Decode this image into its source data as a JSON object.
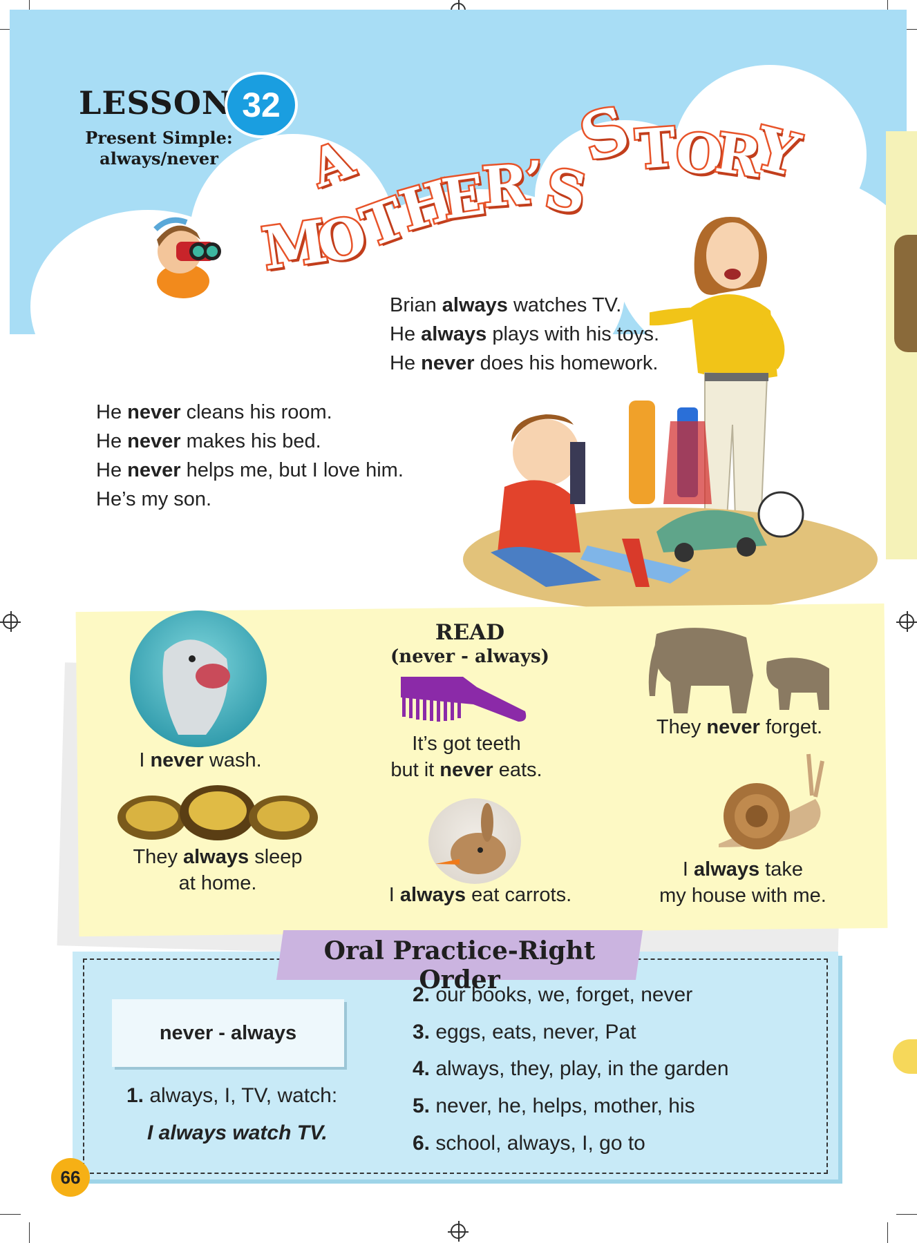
{
  "lesson": {
    "word": "LESSON",
    "number": "32",
    "subtitle_line1": "Present Simple:",
    "subtitle_line2": "always/never"
  },
  "title": {
    "letters_a": "A",
    "letters_mothers": [
      "M",
      "O",
      "T",
      "H",
      "E",
      "R",
      "’",
      "S"
    ],
    "letters_story": [
      "S",
      "T",
      "O",
      "R",
      "Y"
    ]
  },
  "story": {
    "right": [
      {
        "pre": "Brian ",
        "bold": "always",
        "post": " watches TV."
      },
      {
        "pre": "He ",
        "bold": "always",
        "post": " plays with his toys."
      },
      {
        "pre": "He ",
        "bold": "never",
        "post": " does his homework."
      }
    ],
    "left": [
      {
        "pre": "He ",
        "bold": "never",
        "post": " cleans his room."
      },
      {
        "pre": "He ",
        "bold": "never",
        "post": " makes his bed."
      },
      {
        "pre": "He ",
        "bold": "never",
        "post": " helps me, but I love him."
      },
      {
        "pre": "He’s my son.",
        "bold": "",
        "post": ""
      }
    ]
  },
  "read": {
    "heading": "READ",
    "subheading": "(never - always)",
    "captions": {
      "dolphin": {
        "pre": "I ",
        "bold": "never",
        "post": " wash."
      },
      "comb_l1": "It’s got teeth",
      "comb_l2": {
        "pre": "but it ",
        "bold": "never",
        "post": " eats."
      },
      "elephants": {
        "pre": "They ",
        "bold": "never",
        "post": " forget."
      },
      "tortoises_l1": {
        "pre": "They ",
        "bold": "always",
        "post": " sleep"
      },
      "tortoises_l2": "at home.",
      "rabbit": {
        "pre": "I ",
        "bold": "always",
        "post": " eat carrots."
      },
      "snail_l1": {
        "pre": "I ",
        "bold": "always",
        "post": " take"
      },
      "snail_l2": "my house with me."
    }
  },
  "oral": {
    "title": "Oral Practice-Right Order",
    "word_box": "never - always",
    "example": {
      "num": "1.",
      "text": " always, I, TV, watch:",
      "answer": "I always watch TV."
    },
    "items": [
      {
        "num": "2.",
        "text": " our books, we, forget, never"
      },
      {
        "num": "3.",
        "text": " eggs, eats, never, Pat"
      },
      {
        "num": "4.",
        "text": " always, they, play, in the garden"
      },
      {
        "num": "5.",
        "text": " never, he, helps, mother, his"
      },
      {
        "num": "6.",
        "text": " school, always, I, go to"
      }
    ]
  },
  "page_number": "66",
  "colors": {
    "sky": "#a8ddf5",
    "title_orange": "#e8542a",
    "badge_blue": "#1a9ee0",
    "read_panel": "#fdf9c4",
    "oral_box": "#c8eaf7",
    "oral_title": "#cbb4e0",
    "page_num": "#f6b015"
  }
}
